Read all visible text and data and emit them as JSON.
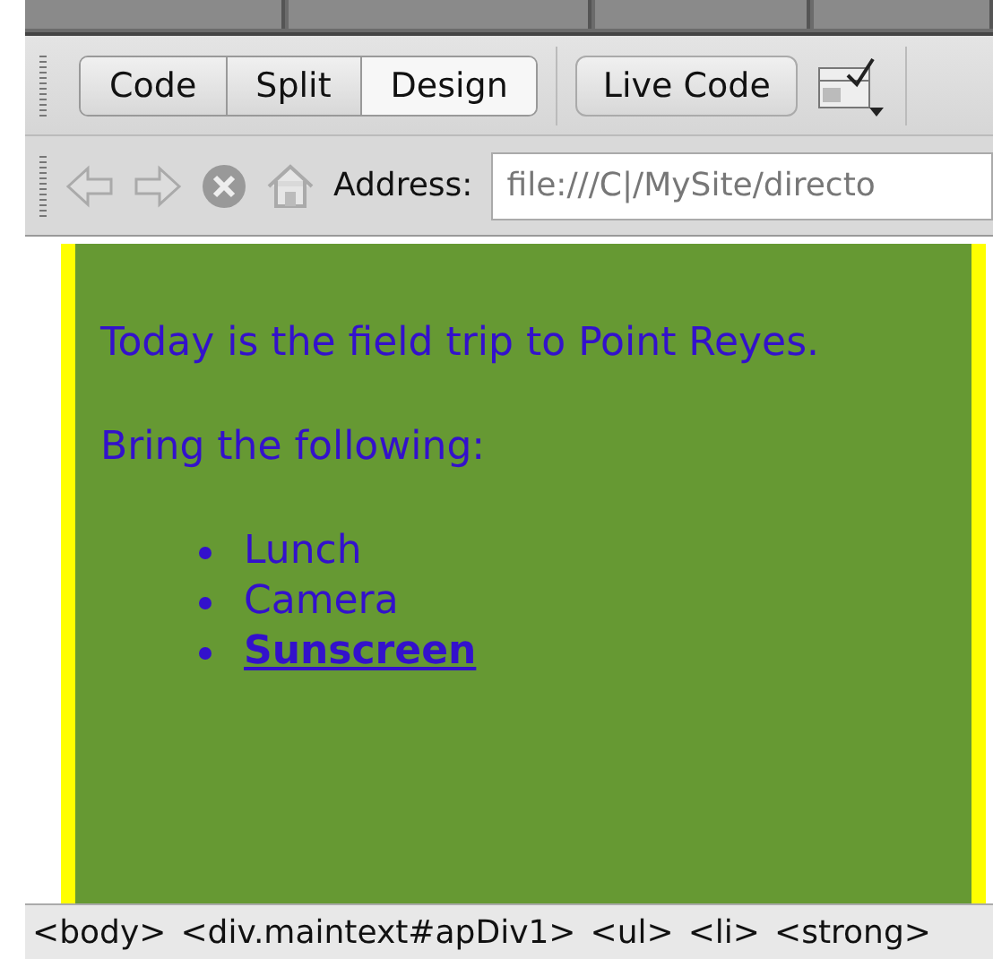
{
  "document_tabs": [
    {
      "selected": false
    },
    {
      "selected": false
    },
    {
      "selected": false
    },
    {
      "selected": false
    }
  ],
  "view_buttons": [
    {
      "label": "Code",
      "selected": false
    },
    {
      "label": "Split",
      "selected": false
    },
    {
      "label": "Design",
      "selected": true
    }
  ],
  "live_code_button": {
    "label": "Live Code"
  },
  "address_bar": {
    "label": "Address:",
    "value": "file:///C|/MySite/directo"
  },
  "content": {
    "paragraphs": [
      "Today is the field trip to Point Reyes.",
      "Bring the following:"
    ],
    "list_items": [
      {
        "text": "Lunch",
        "bold": false
      },
      {
        "text": "Camera",
        "bold": false
      },
      {
        "text": "Sunscreen",
        "bold": true
      }
    ]
  },
  "tag_selector": [
    "<body>",
    "<div.maintext#apDiv1>",
    "<ul>",
    "<li>",
    "<strong>"
  ]
}
